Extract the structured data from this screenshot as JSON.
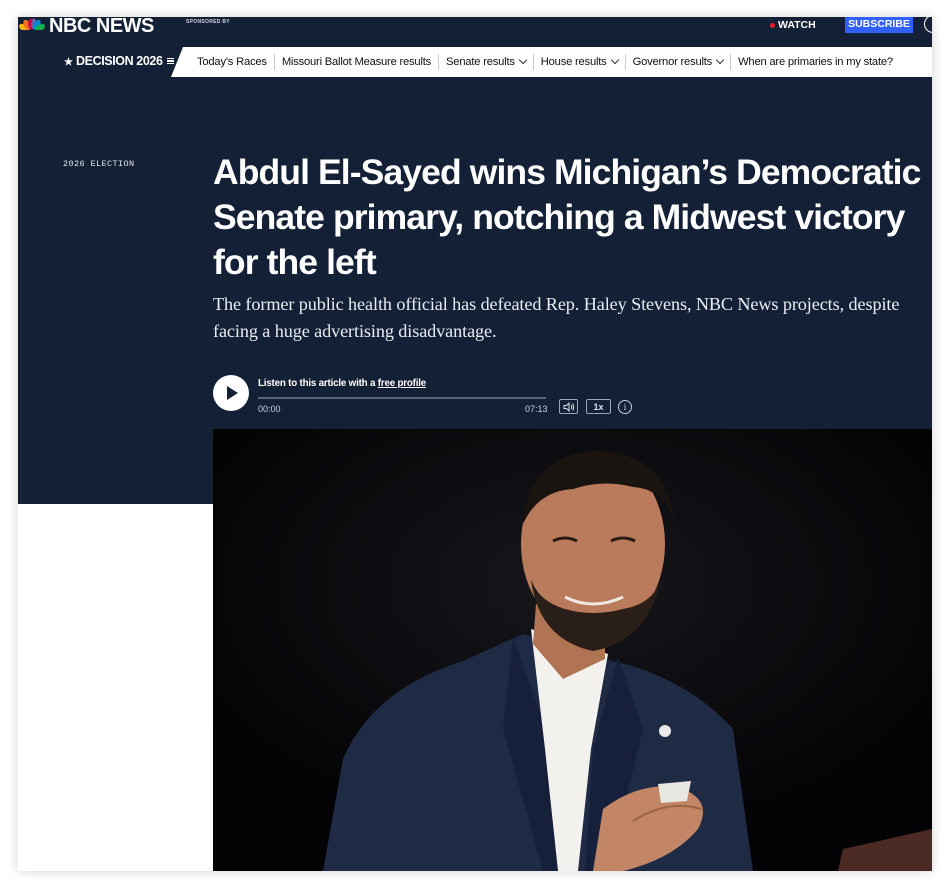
{
  "header": {
    "logo_text": "NBC NEWS",
    "sponsored_label": "SPONSORED BY",
    "watch_label": "WATCH",
    "subscribe_label": "SUBSCRIBE"
  },
  "subnav": {
    "brand": "DECISION 2026",
    "items": [
      {
        "label": "Today's Races",
        "has_dropdown": false
      },
      {
        "label": "Missouri Ballot Measure results",
        "has_dropdown": false
      },
      {
        "label": "Senate results",
        "has_dropdown": true
      },
      {
        "label": "House results",
        "has_dropdown": true
      },
      {
        "label": "Governor results",
        "has_dropdown": true
      },
      {
        "label": "When are primaries in my state?",
        "has_dropdown": false
      }
    ]
  },
  "article": {
    "eyebrow": "2026 ELECTION",
    "headline": "Abdul El-Sayed wins Michigan’s Democratic Senate primary, notching a Midwest victory for the left",
    "dek": "The former public health official has defeated Rep. Haley Stevens, NBC News projects, despite facing a huge advertising disadvantage."
  },
  "audio": {
    "listen_text": "Listen to this article with a",
    "listen_link": "free profile",
    "elapsed": "00:00",
    "duration": "07:13",
    "speed": "1x",
    "progress": 0.0
  },
  "colors": {
    "navy": "#132036",
    "subscribe_blue": "#3061ff",
    "live_red": "#e41e2b"
  },
  "icons": [
    "nbc-peacock-icon",
    "live-dot-icon",
    "user-icon",
    "chevron-down-icon",
    "play-icon",
    "volume-icon",
    "info-icon"
  ]
}
